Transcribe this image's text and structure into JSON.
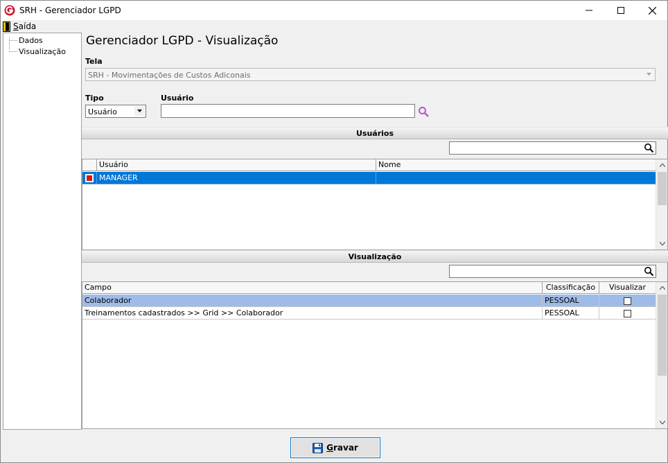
{
  "window": {
    "title": "SRH - Gerenciador LGPD"
  },
  "menu": {
    "exit_first": "S",
    "exit_rest": "aída"
  },
  "tree": {
    "items": [
      {
        "label": "Dados"
      },
      {
        "label": "Visualização"
      }
    ]
  },
  "page": {
    "heading": "Gerenciador LGPD - Visualização"
  },
  "form": {
    "tela_label": "Tela",
    "tela_value": "SRH - Movimentações de Custos Adiconais",
    "tipo_label": "Tipo",
    "tipo_value": "Usuário",
    "usuario_label": "Usuário",
    "usuario_value": ""
  },
  "users_section": {
    "title": "Usuários",
    "search_value": "",
    "columns": [
      "Usuário",
      "Nome"
    ],
    "rows": [
      {
        "usuario": "MANAGER",
        "nome": "",
        "checked": true
      }
    ]
  },
  "view_section": {
    "title": "Visualização",
    "search_value": "",
    "columns": [
      "Campo",
      "Classificação",
      "Visualizar"
    ],
    "rows": [
      {
        "campo": "Colaborador",
        "classificacao": "PESSOAL",
        "visualizar": false
      },
      {
        "campo": "Treinamentos cadastrados >> Grid >> Colaborador",
        "classificacao": "PESSOAL",
        "visualizar": false
      }
    ]
  },
  "save_button": {
    "first": "G",
    "rest": "ravar"
  },
  "colors": {
    "selection": "#0078d7",
    "selection_light": "#9fbbe8",
    "accent": "#c8102e"
  },
  "icons": [
    "app-logo-icon",
    "exit-door-icon",
    "search-icon",
    "magnifier-icon",
    "floppy-disk-icon",
    "minimize-icon",
    "maximize-icon",
    "close-icon"
  ]
}
